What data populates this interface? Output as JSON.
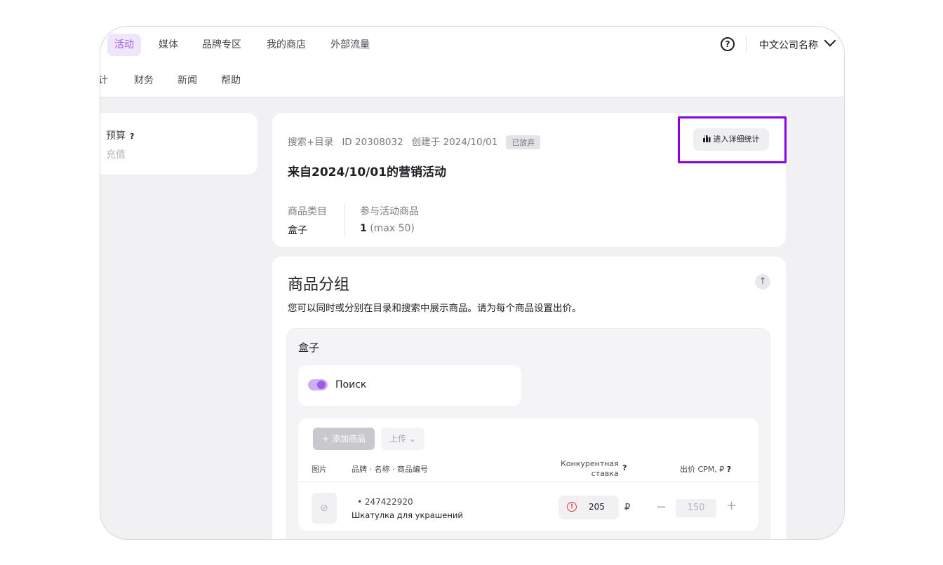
{
  "nav": {
    "items": [
      "活动",
      "媒体",
      "品牌专区",
      "我的商店",
      "外部流量"
    ],
    "sub_items": [
      "计",
      "财务",
      "新闻",
      "帮助"
    ],
    "help_icon": "question-circle-icon",
    "company": "中文公司名称"
  },
  "budget": {
    "label": "预算",
    "help": "?",
    "recharge": "充值"
  },
  "campaign": {
    "type": "搜索+目录",
    "id": "ID 20308032",
    "created": "创建于 2024/10/01",
    "status": "已放弃",
    "title": "来自2024/10/01的营销活动",
    "stats_button": "进入详细统计",
    "category_label": "商品类目",
    "category_value": "盒子",
    "products_label": "参与活动商品",
    "products_count": "1",
    "products_max": "(max 50)"
  },
  "group": {
    "title": "商品分组",
    "description": "您可以同时或分别在目录和搜索中展示商品。请为每个商品设置出价。",
    "inner_title": "盒子",
    "toggle_label": "Поиск",
    "toggle_on": true,
    "add_button": "+ 添加商品",
    "upload_button": "上传",
    "columns": {
      "image": "图片",
      "brand": "品牌 · 名称 · 商品编号",
      "competitive_1": "Конкурентная",
      "competitive_2": "ставка",
      "competitive_help": "?",
      "bid": "出价 CPM, ₽",
      "bid_help": "?"
    },
    "rows": [
      {
        "sku": "• 247422920",
        "name": "Шкатулка для украшений",
        "competitive_bid": "205",
        "currency": "₽",
        "bid": "150"
      }
    ]
  }
}
